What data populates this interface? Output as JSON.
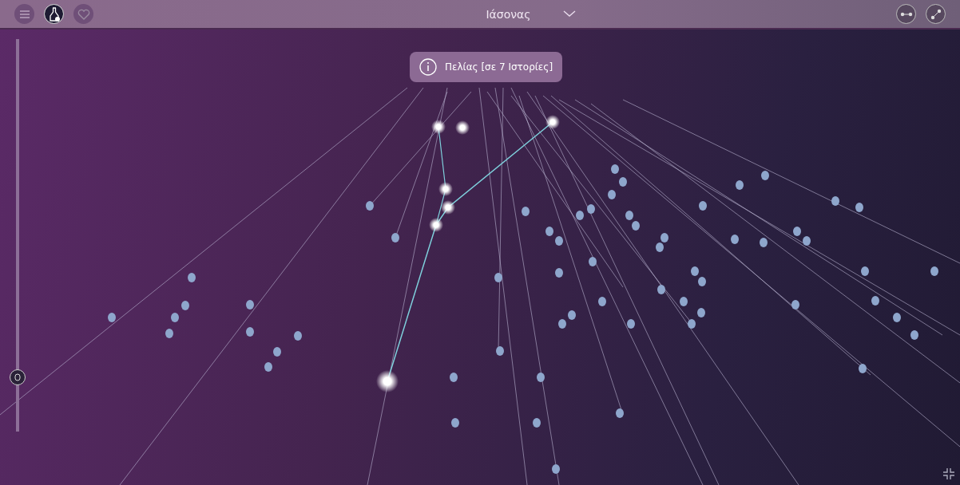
{
  "toolbar": {
    "left_buttons": [
      {
        "kind": "menu",
        "selected": false
      },
      {
        "kind": "flask",
        "selected": true
      },
      {
        "kind": "heart",
        "selected": false
      }
    ],
    "title": "Ιάσονας",
    "right_buttons": [
      {
        "kind": "horizontal"
      },
      {
        "kind": "diagonal"
      }
    ]
  },
  "tooltip": {
    "text": "Πελίας [σε 7 Ιστορίες]"
  },
  "zoom_slider": {
    "level": 0.14
  }
}
